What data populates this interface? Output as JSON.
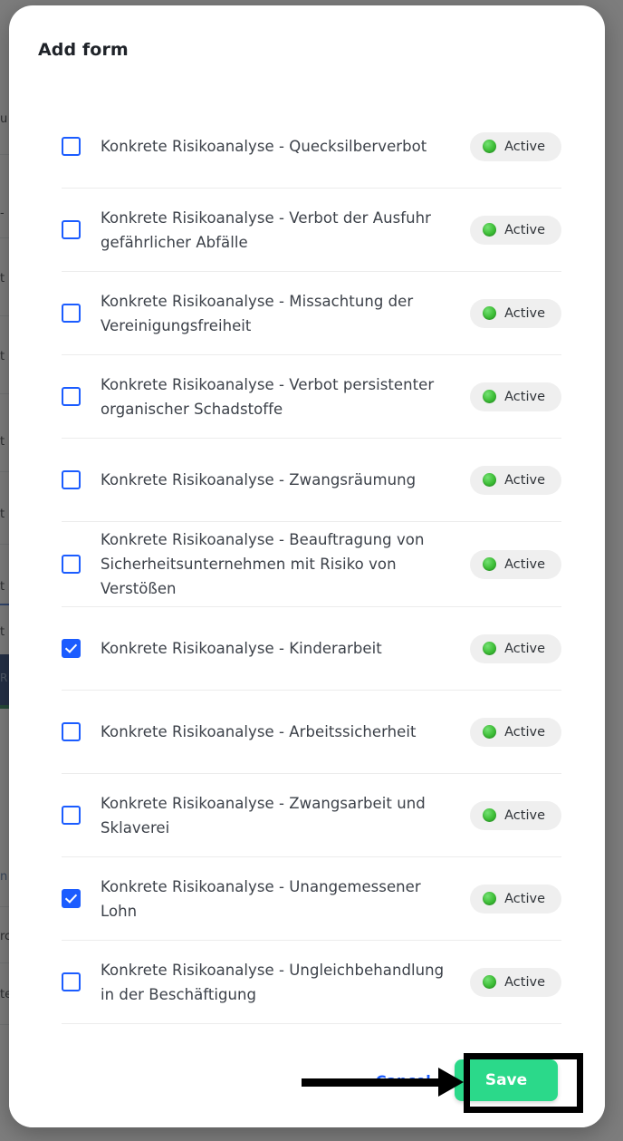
{
  "modal": {
    "title": "Add form",
    "items": [
      {
        "label": "Konkrete Risikoanalyse - Quecksilberverbot",
        "checked": false,
        "status": "Active"
      },
      {
        "label": "Konkrete Risikoanalyse - Verbot der Ausfuhr gefährlicher Abfälle",
        "checked": false,
        "status": "Active"
      },
      {
        "label": "Konkrete Risikoanalyse - Missachtung der Vereinigungsfreiheit",
        "checked": false,
        "status": "Active"
      },
      {
        "label": "Konkrete Risikoanalyse - Verbot persistenter organischer Schadstoffe",
        "checked": false,
        "status": "Active"
      },
      {
        "label": "Konkrete Risikoanalyse - Zwangsräumung",
        "checked": false,
        "status": "Active"
      },
      {
        "label": "Konkrete Risikoanalyse - Beauftragung von Sicherheitsunternehmen mit Risiko von Verstößen",
        "checked": false,
        "status": "Active"
      },
      {
        "label": "Konkrete Risikoanalyse - Kinderarbeit",
        "checked": true,
        "status": "Active"
      },
      {
        "label": "Konkrete Risikoanalyse - Arbeitssicherheit",
        "checked": false,
        "status": "Active"
      },
      {
        "label": "Konkrete Risikoanalyse - Zwangsarbeit und Sklaverei",
        "checked": false,
        "status": "Active"
      },
      {
        "label": "Konkrete Risikoanalyse - Unangemessener Lohn",
        "checked": true,
        "status": "Active"
      },
      {
        "label": "Konkrete Risikoanalyse - Ungleichbehandlung in der Beschäftigung",
        "checked": false,
        "status": "Active"
      }
    ],
    "footer": {
      "cancel_label": "Cancel",
      "save_label": "Save"
    }
  },
  "background": {
    "fragments": [
      "u",
      "-",
      "t",
      "t",
      "t",
      "t",
      "t",
      "t",
      "R",
      "n",
      "rc",
      "te"
    ]
  },
  "colors": {
    "checkbox_blue": "#1b5cff",
    "status_green": "#3fbf38",
    "save_green": "#2bd98a",
    "cancel_blue": "#1b5cff",
    "annotation_black": "#000000",
    "overlay": "rgba(45,45,45,0.62)",
    "sidebar_blue": "#19366f"
  }
}
